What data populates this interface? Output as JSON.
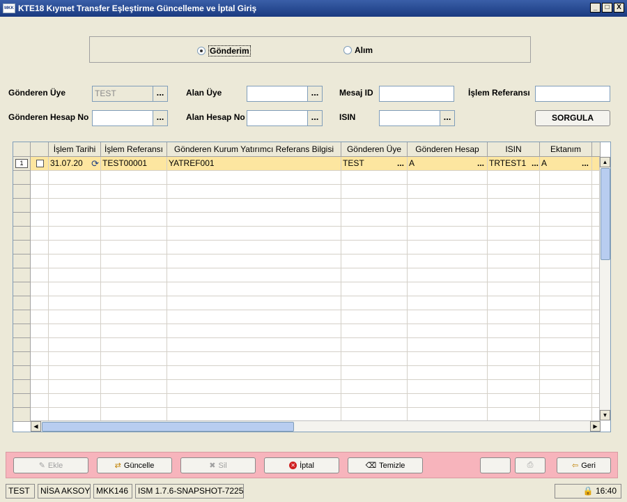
{
  "window": {
    "app_icon_text": "MKK",
    "title": "KTE18 Kıymet Transfer Eşleştirme Güncelleme ve İptal Giriş",
    "minimize": "_",
    "maximize": "□",
    "close": "X"
  },
  "radio": {
    "gonderim": "Gönderim",
    "alim": "Alım",
    "selected": "gonderim"
  },
  "form": {
    "gonderen_uye_label": "Gönderen Üye",
    "gonderen_uye_value": "TEST",
    "gonderen_hesap_label": "Gönderen Hesap No",
    "gonderen_hesap_value": "",
    "alan_uye_label": "Alan Üye",
    "alan_uye_value": "",
    "alan_hesap_label": "Alan Hesap No",
    "alan_hesap_value": "",
    "mesaj_id_label": "Mesaj ID",
    "mesaj_id_value": "",
    "isin_label": "ISIN",
    "isin_value": "",
    "islem_ref_label": "İşlem Referansı",
    "islem_ref_value": "",
    "lookup": "...",
    "sorgula": "SORGULA"
  },
  "grid": {
    "columns": [
      "",
      "İşlem Tarihi",
      "İşlem Referansı",
      "Gönderen Kurum Yatırımcı Referans Bilgisi",
      "Gönderen Üye",
      "Gönderen Hesap",
      "ISIN",
      "Ektanım"
    ],
    "rows": [
      {
        "num": "1",
        "tarih": "31.07.20",
        "ref": "TEST00001",
        "yat_ref": "YATREF001",
        "uye": "TEST",
        "hesap": "A",
        "isin": "TRTEST1",
        "ektanim": "A"
      }
    ],
    "empty_rows": 18
  },
  "toolbar": {
    "ekle": "Ekle",
    "guncelle": "Güncelle",
    "sil": "Sil",
    "iptal": "İptal",
    "temizle": "Temizle",
    "geri": "Geri"
  },
  "status": {
    "user_code": "TEST",
    "user_name": "NİSA AKSOY",
    "screen_code": "MKK146",
    "version": "ISM 1.7.6-SNAPSHOT-7225",
    "time": "16:40"
  }
}
